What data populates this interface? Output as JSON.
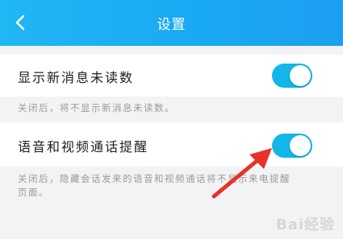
{
  "header": {
    "title": "设置",
    "back_icon": "chevron-left-icon"
  },
  "settings": [
    {
      "label": "显示新消息未读数",
      "enabled": true,
      "hint": "关闭后，将不显示新消息未读数。"
    },
    {
      "label": "语音和视频通话提醒",
      "enabled": true,
      "hint_line1": "关闭后，隐藏会话发来的语音和视频通话将不显示来电提醒",
      "hint_line2": "页面。"
    }
  ],
  "watermark": "Bai经验",
  "colors": {
    "header": "#1fa9f3",
    "toggle_on": "#12b6e9",
    "annotation_arrow": "#e8312a"
  }
}
